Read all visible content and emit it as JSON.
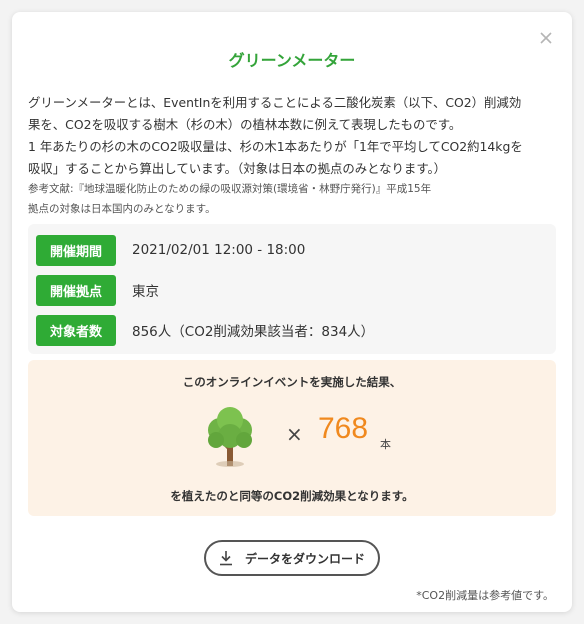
{
  "modal": {
    "title": "グリーンメーター",
    "close_icon": "close-icon"
  },
  "description": {
    "lines": [
      "グリーンメーターとは、EventInを利用することによる二酸化炭素（以下、CO2）削減効",
      "果を、CO2を吸収する樹木（杉の木）の植林本数に例えて表現したものです。",
      "1 年あたりの杉の木のCO2吸収量は、杉の木1本あたりが「1年で平均してCO2約14kgを",
      "吸収」することから算出しています。（対象は日本の拠点のみとなります。）"
    ]
  },
  "reference": {
    "lines": [
      "参考文献:『地球温暖化防止のための緑の吸収源対策(環境省・林野庁発行)』平成15年",
      "拠点の対象は日本国内のみとなります。"
    ]
  },
  "info": {
    "rows": [
      {
        "label": "開催期間",
        "value": "2021/02/01 12:00 - 18:00"
      },
      {
        "label": "開催拠点",
        "value": "東京"
      },
      {
        "label": "対象者数",
        "value": "856人（CO2削減効果該当者：834人）"
      }
    ]
  },
  "result": {
    "intro": "このオンラインイベントを実施した結果、",
    "tree_icon": "tree-icon",
    "times_symbol": "×",
    "count": "768",
    "unit": "本",
    "outro": "を植えたのと同等のCO2削減効果となります。"
  },
  "download": {
    "icon": "download-icon",
    "label": "データをダウンロード"
  },
  "footnote": "*CO2削減量は参考値です。",
  "colors": {
    "accent_green": "#2fab35",
    "title_green": "#34a43a",
    "count_orange": "#f0891e",
    "result_bg": "#fdf2e6",
    "info_bg": "#f6f6f6"
  }
}
